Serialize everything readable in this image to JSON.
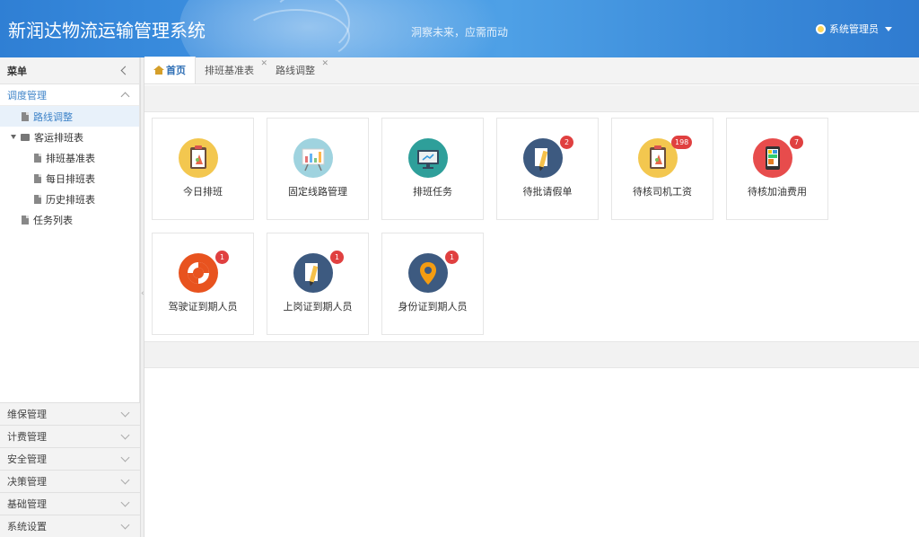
{
  "header": {
    "title": "新润达物流运输管理系统",
    "slogan": "洞察未来，应需而动",
    "user": "系统管理员"
  },
  "sidebar": {
    "menu_title": "菜单",
    "active_group": "调度管理",
    "items": [
      {
        "label": "路线调整",
        "level": 1,
        "type": "file",
        "active": true
      },
      {
        "label": "客运排班表",
        "level": 1,
        "type": "folder",
        "expanded": true
      },
      {
        "label": "排班基准表",
        "level": 2,
        "type": "file"
      },
      {
        "label": "每日排班表",
        "level": 2,
        "type": "file"
      },
      {
        "label": "历史排班表",
        "level": 2,
        "type": "file"
      },
      {
        "label": "任务列表",
        "level": 1,
        "type": "file"
      }
    ],
    "collapsed_groups": [
      "维保管理",
      "计费管理",
      "安全管理",
      "决策管理",
      "基础管理",
      "系统设置"
    ]
  },
  "tabs": [
    {
      "label": "首页",
      "active": true
    },
    {
      "label": "排班基准表",
      "closable": true
    },
    {
      "label": "路线调整",
      "closable": true
    }
  ],
  "dashboard": {
    "cards": [
      {
        "label": "今日排班",
        "icon": "clipboard-icon",
        "badge": null
      },
      {
        "label": "固定线路管理",
        "icon": "chart-board-icon",
        "badge": null
      },
      {
        "label": "排班任务",
        "icon": "monitor-icon",
        "badge": null
      },
      {
        "label": "待批请假单",
        "icon": "pen-document-icon",
        "badge": "2"
      },
      {
        "label": "待核司机工资",
        "icon": "clipboard-icon",
        "badge": "198"
      },
      {
        "label": "待核加油费用",
        "icon": "tablet-icon",
        "badge": "7"
      },
      {
        "label": "驾驶证到期人员",
        "icon": "lifebuoy-icon",
        "badge": "1"
      },
      {
        "label": "上岗证到期人员",
        "icon": "pen-document-icon",
        "badge": "1"
      },
      {
        "label": "身份证到期人员",
        "icon": "map-pin-icon",
        "badge": "1"
      }
    ]
  },
  "colors": {
    "header_bg": "#3a8ad9",
    "accent": "#3f84c9",
    "badge": "#e04040"
  }
}
